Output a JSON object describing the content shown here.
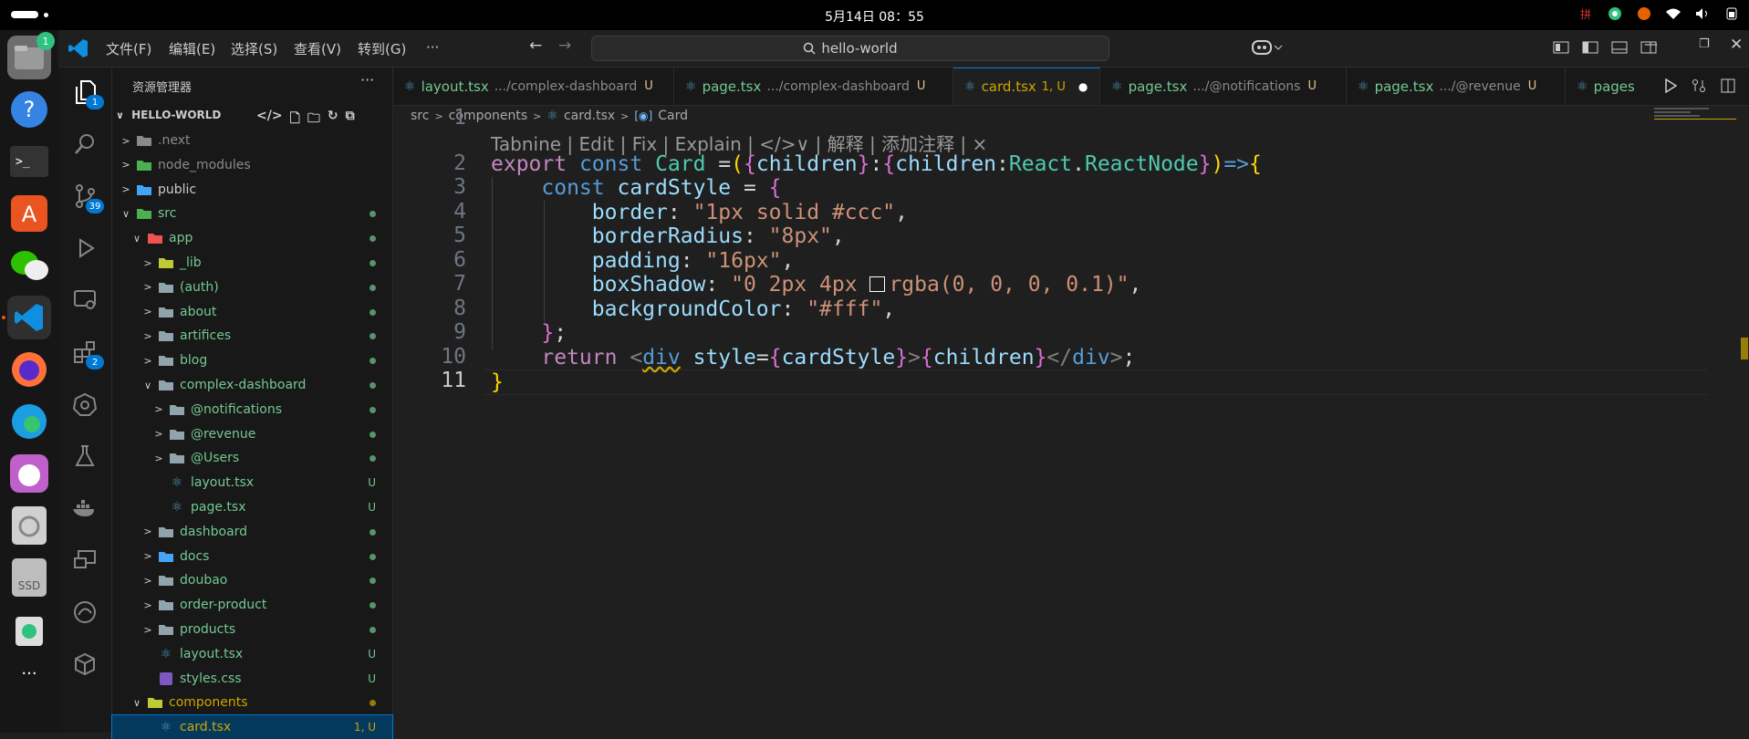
{
  "system": {
    "clock": "5月14日  08：55",
    "ime": "拼"
  },
  "dock": {
    "files_badge": "1",
    "ssd_label": "SSD"
  },
  "menubar": {
    "items": [
      "文件(F)",
      "编辑(E)",
      "选择(S)",
      "查看(V)",
      "转到(G)",
      "···"
    ],
    "search_text": "hello-world"
  },
  "activity": {
    "explorer_badge": "1",
    "scm_badge": "39",
    "extensions_badge": "2"
  },
  "sidebar": {
    "title": "资源管理器",
    "project": "HELLO-WORLD",
    "tree": [
      {
        "label": ".next",
        "status": "",
        "expanded": false
      },
      {
        "label": "node_modules",
        "status": "",
        "expanded": false
      },
      {
        "label": "public",
        "status": "",
        "expanded": false
      },
      {
        "label": "src",
        "status": "dot",
        "expanded": true
      },
      {
        "label": "app",
        "status": "dot",
        "expanded": true
      },
      {
        "label": "_lib",
        "status": "dot",
        "expanded": false
      },
      {
        "label": "(auth)",
        "status": "dot",
        "expanded": false
      },
      {
        "label": "about",
        "status": "dot",
        "expanded": false
      },
      {
        "label": "artifices",
        "status": "dot",
        "expanded": false
      },
      {
        "label": "blog",
        "status": "dot",
        "expanded": false
      },
      {
        "label": "complex-dashboard",
        "status": "dot",
        "expanded": true
      },
      {
        "label": "@notifications",
        "status": "dot",
        "expanded": false
      },
      {
        "label": "@revenue",
        "status": "dot",
        "expanded": false
      },
      {
        "label": "@Users",
        "status": "dot",
        "expanded": false
      },
      {
        "label": "layout.tsx",
        "status": "U"
      },
      {
        "label": "page.tsx",
        "status": "U"
      },
      {
        "label": "dashboard",
        "status": "dot",
        "expanded": false
      },
      {
        "label": "docs",
        "status": "dot",
        "expanded": false
      },
      {
        "label": "doubao",
        "status": "dot",
        "expanded": false
      },
      {
        "label": "order-product",
        "status": "dot",
        "expanded": false
      },
      {
        "label": "products",
        "status": "dot",
        "expanded": false
      },
      {
        "label": "layout.tsx",
        "status": "U"
      },
      {
        "label": "styles.css",
        "status": "U"
      },
      {
        "label": "components",
        "status": "dot",
        "expanded": true
      },
      {
        "label": "card.tsx",
        "status": "1, U"
      }
    ]
  },
  "tabs": [
    {
      "name": "layout.tsx",
      "path": ".../complex-dashboard",
      "status": "U"
    },
    {
      "name": "page.tsx",
      "path": ".../complex-dashboard",
      "status": "U"
    },
    {
      "name": "card.tsx",
      "path": "",
      "status": "1, U"
    },
    {
      "name": "page.tsx",
      "path": ".../@notifications",
      "status": "U"
    },
    {
      "name": "page.tsx",
      "path": ".../@revenue",
      "status": "U"
    },
    {
      "name": "pages",
      "path": "",
      "status": ""
    }
  ],
  "breadcrumb": [
    "src",
    "components",
    "card.tsx",
    "Card"
  ],
  "codelens": "Tabnine | Edit | Fix | Explain | </>∨ | 解释 | 添加注释 | ×",
  "line_numbers": [
    "1",
    "2",
    "3",
    "4",
    "5",
    "6",
    "7",
    "8",
    "9",
    "10",
    "11"
  ]
}
